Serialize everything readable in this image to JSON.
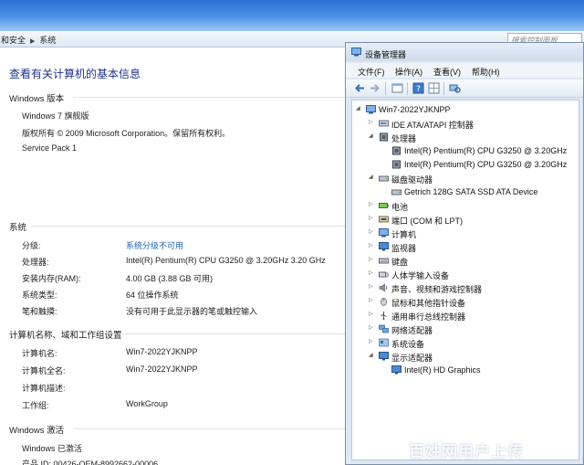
{
  "address": {
    "crumb_parent": "和安全",
    "crumb_current": "系统",
    "search_placeholder": "搜索控制面板"
  },
  "system_info": {
    "page_title": "查看有关计算机的基本信息",
    "edition_section": "Windows 版本",
    "edition_name": "Windows 7 旗舰版",
    "copyright": "版权所有 © 2009 Microsoft Corporation。保留所有权利。",
    "service_pack": "Service Pack 1",
    "system_section": "系统",
    "rating_label": "分级:",
    "rating_value": "系统分级不可用",
    "processor_label": "处理器:",
    "processor_value": "Intel(R) Pentium(R) CPU G3250 @ 3.20GHz   3.20 GHz",
    "ram_label": "安装内存(RAM):",
    "ram_value": "4.00 GB (3.88 GB 可用)",
    "type_label": "系统类型:",
    "type_value": "64 位操作系统",
    "pen_label": "笔和触摸:",
    "pen_value": "没有可用于此显示器的笔或触控输入",
    "computer_section": "计算机名称、域和工作组设置",
    "name_label": "计算机名:",
    "name_value": "Win7-2022YJKNPP",
    "fullname_label": "计算机全名:",
    "fullname_value": "Win7-2022YJKNPP",
    "desc_label": "计算机描述:",
    "workgroup_label": "工作组:",
    "workgroup_value": "WorkGroup",
    "activation_section": "Windows 激活",
    "activation_status": "Windows 已激活",
    "product_id": "产品 ID: 00426-OEM-8992662-00006"
  },
  "device_manager": {
    "title": "设备管理器",
    "menu": [
      "文件(F)",
      "操作(A)",
      "查看(V)",
      "帮助(H)"
    ],
    "root": "Win7-2022YJKNPP",
    "nodes": [
      "IDE ATA/ATAPI 控制器",
      "处理器",
      "Intel(R) Pentium(R) CPU G3250 @ 3.20GHz",
      "Intel(R) Pentium(R) CPU G3250 @ 3.20GHz",
      "磁盘驱动器",
      "Getrich 128G SATA SSD ATA Device",
      "电池",
      "端口 (COM 和 LPT)",
      "计算机",
      "监视器",
      "键盘",
      "人体学输入设备",
      "声音、视频和游戏控制器",
      "鼠标和其他指针设备",
      "通用串行总线控制器",
      "网络适配器",
      "系统设备",
      "显示适配器",
      "Intel(R) HD Graphics"
    ]
  },
  "watermark": "百姓网用户上传"
}
